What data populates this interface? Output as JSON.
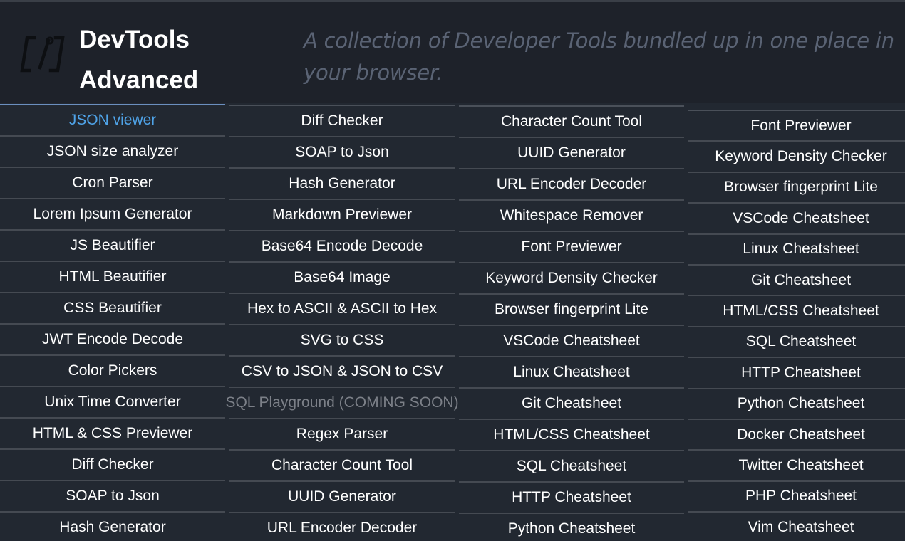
{
  "header": {
    "brand_line1": "DevTools",
    "brand_line2": "Advanced",
    "tagline": "A collection of Developer Tools bundled up in one place in your browser.",
    "logo_icon": "bracket-code-icon"
  },
  "colors": {
    "background": "#222831",
    "header_background": "#1e222a",
    "active_link": "#4fa3e8",
    "disabled_link": "#7c8088",
    "tagline": "#5a6374"
  },
  "columns": [
    {
      "items": [
        {
          "label": "JSON viewer",
          "state": "active"
        },
        {
          "label": "JSON size analyzer"
        },
        {
          "label": "Cron Parser"
        },
        {
          "label": "Lorem Ipsum Generator"
        },
        {
          "label": "JS Beautifier"
        },
        {
          "label": "HTML Beautifier"
        },
        {
          "label": "CSS Beautifier"
        },
        {
          "label": "JWT Encode Decode"
        },
        {
          "label": "Color Pickers"
        },
        {
          "label": "Unix Time Converter"
        },
        {
          "label": "HTML & CSS Previewer"
        },
        {
          "label": "Diff Checker"
        },
        {
          "label": "SOAP to Json"
        },
        {
          "label": "Hash Generator"
        }
      ]
    },
    {
      "items": [
        {
          "label": "Diff Checker"
        },
        {
          "label": "SOAP to Json"
        },
        {
          "label": "Hash Generator"
        },
        {
          "label": "Markdown Previewer"
        },
        {
          "label": "Base64 Encode Decode"
        },
        {
          "label": "Base64 Image"
        },
        {
          "label": "Hex to ASCII & ASCII to Hex"
        },
        {
          "label": "SVG to CSS"
        },
        {
          "label": "CSV to JSON & JSON to CSV"
        },
        {
          "label": "SQL Playground (COMING SOON)",
          "state": "disabled"
        },
        {
          "label": "Regex Parser"
        },
        {
          "label": "Character Count Tool"
        },
        {
          "label": "UUID Generator"
        },
        {
          "label": "URL Encoder Decoder"
        }
      ]
    },
    {
      "items": [
        {
          "label": "Character Count Tool"
        },
        {
          "label": "UUID Generator"
        },
        {
          "label": "URL Encoder Decoder"
        },
        {
          "label": "Whitespace Remover"
        },
        {
          "label": "Font Previewer"
        },
        {
          "label": "Keyword Density Checker"
        },
        {
          "label": "Browser fingerprint Lite"
        },
        {
          "label": "VSCode Cheatsheet"
        },
        {
          "label": "Linux Cheatsheet"
        },
        {
          "label": "Git Cheatsheet"
        },
        {
          "label": "HTML/CSS Cheatsheet"
        },
        {
          "label": "SQL Cheatsheet"
        },
        {
          "label": "HTTP Cheatsheet"
        },
        {
          "label": "Python Cheatsheet"
        }
      ]
    },
    {
      "items": [
        {
          "label": "Font Previewer"
        },
        {
          "label": "Keyword Density Checker"
        },
        {
          "label": "Browser fingerprint Lite"
        },
        {
          "label": "VSCode Cheatsheet"
        },
        {
          "label": "Linux Cheatsheet"
        },
        {
          "label": "Git Cheatsheet"
        },
        {
          "label": "HTML/CSS Cheatsheet"
        },
        {
          "label": "SQL Cheatsheet"
        },
        {
          "label": "HTTP Cheatsheet"
        },
        {
          "label": "Python Cheatsheet"
        },
        {
          "label": "Docker Cheatsheet"
        },
        {
          "label": "Twitter Cheatsheet"
        },
        {
          "label": "PHP Cheatsheet"
        },
        {
          "label": "Vim Cheatsheet"
        }
      ]
    }
  ]
}
